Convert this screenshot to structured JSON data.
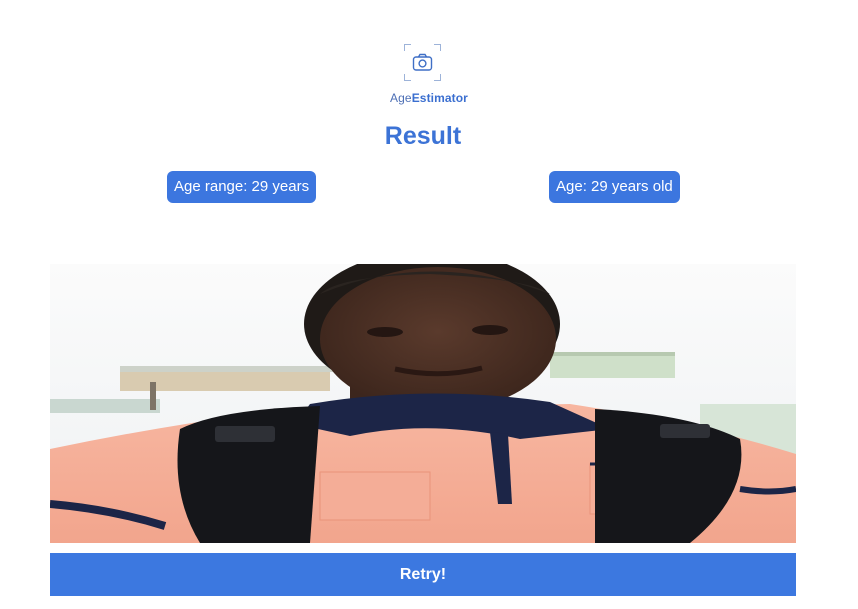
{
  "app": {
    "logo_icon": "camera-viewfinder-icon",
    "brand_part1": "Age",
    "brand_part2": "Estimator",
    "accent_color": "#3c76df"
  },
  "result": {
    "title": "Result",
    "age_range_label": "Age range: 29 years",
    "age_label": "Age: 29 years old"
  },
  "photo": {
    "alt": "Uploaded selfie photo"
  },
  "actions": {
    "retry_label": "Retry!"
  }
}
